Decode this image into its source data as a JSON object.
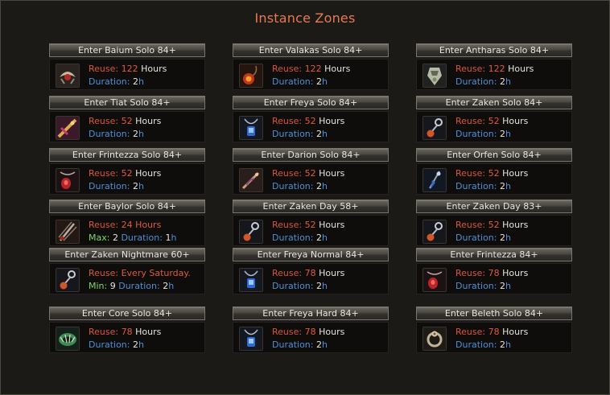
{
  "window": {
    "title": "Instance Zones"
  },
  "labels": {
    "reuse": "Reuse:",
    "duration": "Duration:",
    "max": "Max:",
    "min": "Min:"
  },
  "colors": {
    "title": "#e87a52",
    "reuse": "#d9553d",
    "duration": "#4e8fd6",
    "max_min": "#7fd85e",
    "text": "#e8e4dc"
  },
  "zones": [
    {
      "button": "Enter Baium Solo 84+",
      "icon": "baium-jewel-icon",
      "reuse": "122",
      "reuse_unit": "Hours",
      "duration": "2",
      "duration_unit": "h"
    },
    {
      "button": "Enter Valakas Solo 84+",
      "icon": "valakas-necklace-icon",
      "reuse": "122",
      "reuse_unit": "Hours",
      "duration": "2",
      "duration_unit": "h"
    },
    {
      "button": "Enter Antharas Solo 84+",
      "icon": "antharas-earring-icon",
      "reuse": "122",
      "reuse_unit": "Hours",
      "duration": "2",
      "duration_unit": "h"
    },
    {
      "button": "Enter Tiat Solo 84+",
      "icon": "tiat-weapon-icon",
      "reuse": "52",
      "reuse_unit": "Hours",
      "duration": "2",
      "duration_unit": "h"
    },
    {
      "button": "Enter Freya Solo 84+",
      "icon": "freya-necklace-icon",
      "reuse": "52",
      "reuse_unit": "Hours",
      "duration": "2",
      "duration_unit": "h"
    },
    {
      "button": "Enter Zaken Solo 84+",
      "icon": "zaken-earring-icon",
      "reuse": "52",
      "reuse_unit": "Hours",
      "duration": "2",
      "duration_unit": "h"
    },
    {
      "button": "Enter Frintezza Solo 84+",
      "icon": "frintezza-necklace-icon",
      "reuse": "52",
      "reuse_unit": "Hours",
      "duration": "2",
      "duration_unit": "h"
    },
    {
      "button": "Enter Darion Solo 84+",
      "icon": "darion-weapon-icon",
      "reuse": "52",
      "reuse_unit": "Hours",
      "duration": "2",
      "duration_unit": "h"
    },
    {
      "button": "Enter Orfen Solo 84+",
      "icon": "orfen-earring-icon",
      "reuse": "52",
      "reuse_unit": "Hours",
      "duration": "2",
      "duration_unit": "h"
    },
    {
      "button": "Enter Baylor Solo 84+",
      "icon": "baylor-weapon-icon",
      "reuse_text": "24 Hours",
      "max": "2",
      "duration": "1",
      "duration_unit": "h"
    },
    {
      "button": "Enter Zaken Day 58+",
      "icon": "zaken-earring-icon",
      "reuse": "52",
      "reuse_unit": "Hours",
      "duration": "2",
      "duration_unit": "h"
    },
    {
      "button": "Enter Zaken Day 83+",
      "icon": "zaken-earring-icon",
      "reuse": "52",
      "reuse_unit": "Hours",
      "duration": "2",
      "duration_unit": "h"
    },
    {
      "button": "Enter Zaken Nightmare 60+",
      "icon": "zaken-earring-icon",
      "reuse_text": "Every Saturday.",
      "min": "9",
      "duration": "2",
      "duration_unit": "h"
    },
    {
      "button": "Enter Freya Normal 84+",
      "icon": "freya-necklace-icon",
      "reuse": "78",
      "reuse_unit": "Hours",
      "duration": "2",
      "duration_unit": "h"
    },
    {
      "button": "Enter Frintezza 84+",
      "icon": "frintezza-necklace-icon",
      "reuse": "78",
      "reuse_unit": "Hours",
      "duration": "2",
      "duration_unit": "h"
    },
    {
      "button": "Enter Core Solo 84+",
      "icon": "core-ring-icon",
      "reuse": "78",
      "reuse_unit": "Hours",
      "duration": "2",
      "duration_unit": "h"
    },
    {
      "button": "Enter Freya Hard 84+",
      "icon": "freya-necklace-icon",
      "reuse": "78",
      "reuse_unit": "Hours",
      "duration": "2",
      "duration_unit": "h"
    },
    {
      "button": "Enter Beleth Solo 84+",
      "icon": "beleth-ring-icon",
      "reuse": "78",
      "reuse_unit": "Hours",
      "duration": "2",
      "duration_unit": "h"
    }
  ]
}
